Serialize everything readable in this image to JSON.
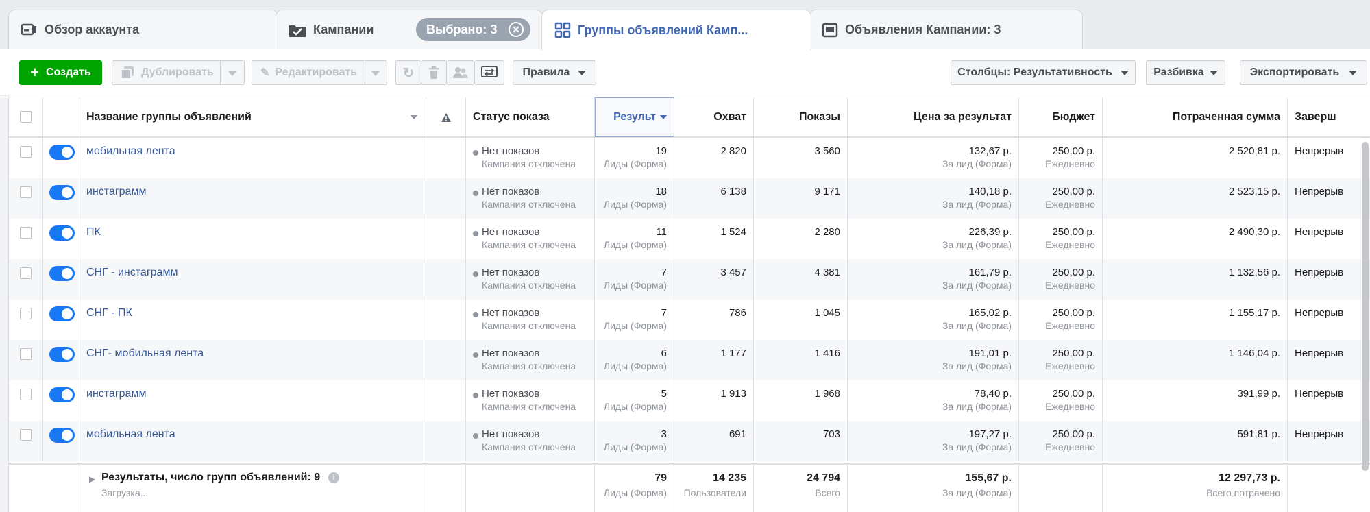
{
  "tabs": {
    "overview": "Обзор аккаунта",
    "campaigns": "Кампании",
    "selected_badge": "Выбрано: 3",
    "adsets": "Группы объявлений Камп...",
    "ads": "Объявления Кампании: 3"
  },
  "toolbar": {
    "create": "Создать",
    "duplicate": "Дублировать",
    "edit": "Редактировать",
    "rules": "Правила",
    "columns": "Столбцы: Результативность",
    "breakdown": "Разбивка",
    "export": "Экспортировать"
  },
  "columns": {
    "name": "Название группы объявлений",
    "status": "Статус показа",
    "results": "Результ",
    "reach": "Охват",
    "impressions": "Показы",
    "cost_per_result": "Цена за результат",
    "budget": "Бюджет",
    "spent": "Потраченная сумма",
    "ends": "Заверш"
  },
  "common": {
    "status_main": "Нет показов",
    "status_sub": "Кампания отключена",
    "results_sub": "Лиды (Форма)",
    "cpr_sub": "За лид (Форма)",
    "budget_value": "250,00 р.",
    "budget_sub": "Ежедневно",
    "ends_value": "Непрерыв"
  },
  "rows": [
    {
      "name": "мобильная лента",
      "results": "19",
      "reach": "2 820",
      "impressions": "3 560",
      "cpr": "132,67 р.",
      "spent": "2 520,81 р."
    },
    {
      "name": "инстаграмм",
      "results": "18",
      "reach": "6 138",
      "impressions": "9 171",
      "cpr": "140,18 р.",
      "spent": "2 523,15 р."
    },
    {
      "name": "ПК",
      "results": "11",
      "reach": "1 524",
      "impressions": "2 280",
      "cpr": "226,39 р.",
      "spent": "2 490,30 р."
    },
    {
      "name": "СНГ - инстаграмм",
      "results": "7",
      "reach": "3 457",
      "impressions": "4 381",
      "cpr": "161,79 р.",
      "spent": "1 132,56 р."
    },
    {
      "name": "СНГ - ПК",
      "results": "7",
      "reach": "786",
      "impressions": "1 045",
      "cpr": "165,02 р.",
      "spent": "1 155,17 р."
    },
    {
      "name": "СНГ- мобильная лента",
      "results": "6",
      "reach": "1 177",
      "impressions": "1 416",
      "cpr": "191,01 р.",
      "spent": "1 146,04 р."
    },
    {
      "name": "инстаграмм",
      "results": "5",
      "reach": "1 913",
      "impressions": "1 968",
      "cpr": "78,40 р.",
      "spent": "391,99 р."
    },
    {
      "name": "мобильная лента",
      "results": "3",
      "reach": "691",
      "impressions": "703",
      "cpr": "197,27 р.",
      "spent": "591,81 р."
    }
  ],
  "totals": {
    "label": "Результаты, число групп объявлений: 9",
    "loading": "Загрузка...",
    "results": "79",
    "results_sub": "Лиды (Форма)",
    "reach": "14 235",
    "reach_sub": "Пользователи",
    "impressions": "24 794",
    "impressions_sub": "Всего",
    "cpr": "155,67 р.",
    "cpr_sub": "За лид (Форма)",
    "spent": "12 297,73 р.",
    "spent_sub": "Всего потрачено"
  }
}
